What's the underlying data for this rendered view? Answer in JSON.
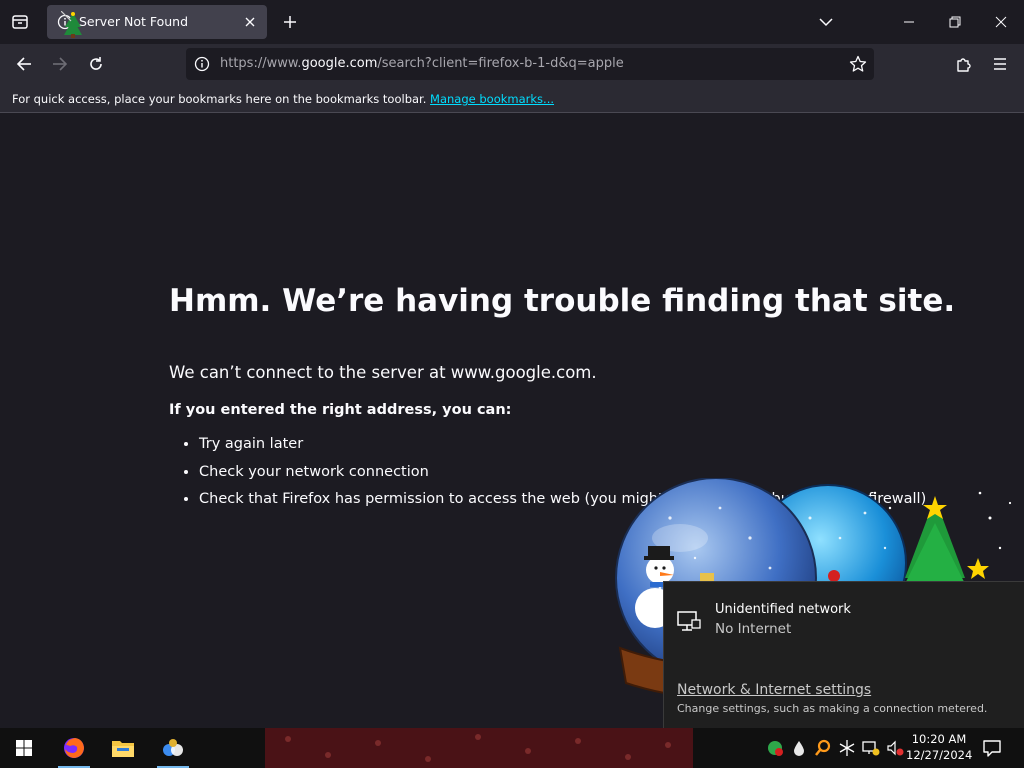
{
  "browser": {
    "tab": {
      "title": "Server Not Found"
    },
    "url": {
      "prefix": "https://www.",
      "host": "google.com",
      "path": "/search?client=firefox-b-1-d&q=apple"
    },
    "bookmarks_bar": {
      "text": "For quick access, place your bookmarks here on the bookmarks toolbar.",
      "link": "Manage bookmarks..."
    }
  },
  "error_page": {
    "title": "Hmm. We’re having trouble finding that site.",
    "description": "We can’t connect to the server at www.google.com.",
    "subtitle": "If you entered the right address, you can:",
    "suggestions": [
      "Try again later",
      "Check your network connection",
      "Check that Firefox has permission to access the web (you might be connected but behind a firewall)"
    ]
  },
  "network_flyout": {
    "network_name": "Unidentified network",
    "status": "No Internet",
    "settings_link": "Network & Internet settings",
    "settings_hint": "Change settings, such as making a connection metered."
  },
  "taskbar": {
    "time": "10:20 AM",
    "date": "12/27/2024",
    "pinned": [
      "windows-start",
      "firefox",
      "file-explorer",
      "app"
    ]
  },
  "colors": {
    "accent_link": "#00ddff",
    "page_bg": "#1c1b22",
    "toolbar_bg": "#2b2a33",
    "taskbar_bg": "#101010"
  }
}
